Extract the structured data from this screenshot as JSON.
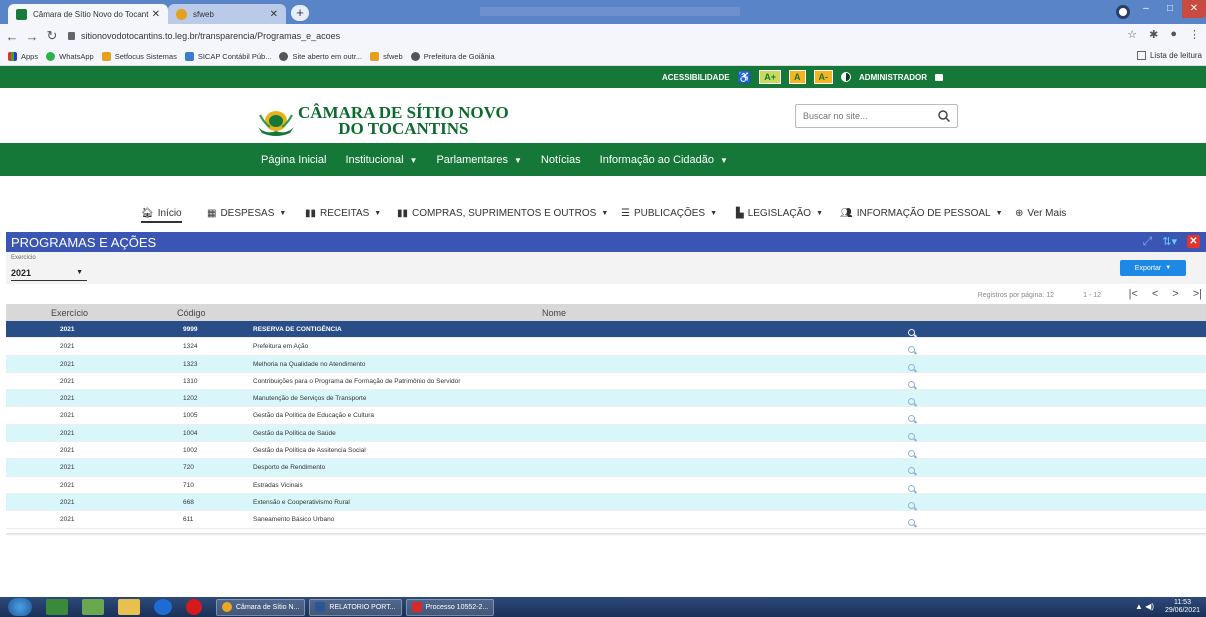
{
  "browser": {
    "tabs": [
      {
        "label": "Câmara de Sítio Novo do Tocant",
        "active": true
      },
      {
        "label": "sfweb",
        "active": false
      }
    ],
    "url": "sitionovodotocantins.to.leg.br/transparencia/Programas_e_acoes",
    "bookmarks": [
      "Apps",
      "WhatsApp",
      "Setfocus Sistemas",
      "SICAP Contábil Púb...",
      "Site aberto em outr...",
      "sfweb",
      "Prefeitura de Goiânia"
    ],
    "reading_list": "Lista de leitura"
  },
  "site": {
    "accessibility": {
      "label": "ACESSIBILIDADE",
      "font_plus": "A+",
      "font_normal": "A",
      "font_minus": "A-",
      "admin": "ADMINISTRADOR"
    },
    "logo_line1": "CÂMARA DE SÍTIO NOVO",
    "logo_line2": "DO TOCANTINS",
    "search_placeholder": "Buscar no site...",
    "nav": [
      {
        "label": "Página Inicial",
        "dropdown": false
      },
      {
        "label": "Institucional",
        "dropdown": true
      },
      {
        "label": "Parlamentares",
        "dropdown": true
      },
      {
        "label": "Notícias",
        "dropdown": false
      },
      {
        "label": "Informação ao Cidadão",
        "dropdown": true
      }
    ]
  },
  "subnav": {
    "inicio": "Início",
    "despesas": "DESPESAS",
    "receitas": "RECEITAS",
    "compras": "COMPRAS, SUPRIMENTOS E OUTROS",
    "publicacoes": "PUBLICAÇÕES",
    "legislacao": "LEGISLAÇÃO",
    "pessoal": "INFORMAÇÃO DE PESSOAL",
    "ver_mais": "Ver Mais"
  },
  "panel": {
    "title": "PROGRAMAS E AÇÕES",
    "exercicio_label": "Exercício",
    "exercicio_value": "2021",
    "export_label": "Exportar",
    "registros_label": "Registros por página:",
    "registros_value": "12",
    "range": "1 - 12",
    "columns": {
      "exercicio": "Exercício",
      "codigo": "Código",
      "nome": "Nome"
    },
    "rows": [
      {
        "exercicio": "2021",
        "codigo": "9999",
        "nome": "RESERVA DE CONTIGÊNCIA",
        "selected": true
      },
      {
        "exercicio": "2021",
        "codigo": "1324",
        "nome": "Prefeitura em Ação"
      },
      {
        "exercicio": "2021",
        "codigo": "1323",
        "nome": "Melhoria na Qualidade no Atendimento"
      },
      {
        "exercicio": "2021",
        "codigo": "1310",
        "nome": "Contribuições para o Programa de Formação de Patrimônio do Servidor"
      },
      {
        "exercicio": "2021",
        "codigo": "1202",
        "nome": "Manutenção de Serviços de Transporte"
      },
      {
        "exercicio": "2021",
        "codigo": "1005",
        "nome": "Gestão da Política de Educação e Cultura"
      },
      {
        "exercicio": "2021",
        "codigo": "1004",
        "nome": "Gestão da Política de Saúde"
      },
      {
        "exercicio": "2021",
        "codigo": "1002",
        "nome": "Gestão da Política de Assitencia Social"
      },
      {
        "exercicio": "2021",
        "codigo": "720",
        "nome": "Desporto de Rendimento"
      },
      {
        "exercicio": "2021",
        "codigo": "710",
        "nome": "Estradas Vicinais"
      },
      {
        "exercicio": "2021",
        "codigo": "668",
        "nome": "Extensão e Cooperativismo Rural"
      },
      {
        "exercicio": "2021",
        "codigo": "611",
        "nome": "Saneamento Básico Urbano"
      }
    ]
  },
  "taskbar": {
    "tasks": [
      "Câmara de Sítio N...",
      "RELATORIO PORT...",
      "Processo 10552-2..."
    ],
    "time": "11:53",
    "date": "29/06/2021"
  },
  "colors": {
    "site_green": "#167838",
    "panel_blue": "#3b55b5",
    "selected_row": "#284d87",
    "alt_row": "#d9f7fa",
    "export_blue": "#1e88e5"
  }
}
